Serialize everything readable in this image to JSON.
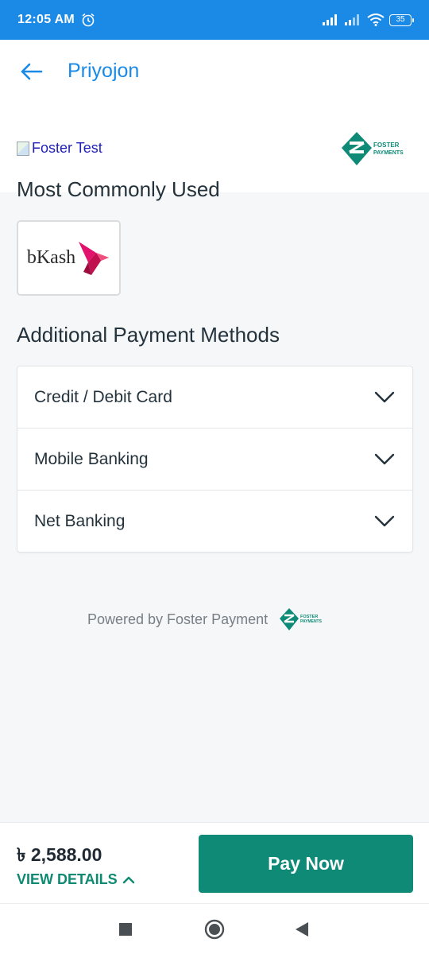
{
  "status_bar": {
    "time": "12:05 AM",
    "battery": "35"
  },
  "header": {
    "title": "Priyojon"
  },
  "merchant": {
    "logo_alt": "Foster Test"
  },
  "brand_logo": {
    "line1": "FOSTER",
    "line2": "PAYMENTS"
  },
  "sections": {
    "common_title": "Most Commonly Used",
    "additional_title": "Additional Payment Methods"
  },
  "common_methods": [
    {
      "label": "bKash"
    }
  ],
  "additional_methods": [
    {
      "label": "Credit / Debit Card"
    },
    {
      "label": "Mobile Banking"
    },
    {
      "label": "Net Banking"
    }
  ],
  "footer": {
    "powered_by": "Powered by Foster Payment"
  },
  "pay_bar": {
    "amount": "৳ 2,588.00",
    "view_details": "VIEW DETAILS",
    "pay_button": "Pay Now"
  },
  "colors": {
    "status_bar": "#1a8ae6",
    "accent_blue": "#1a8ae6",
    "pay_green": "#0e8a76",
    "bkash_pink": "#d2155a"
  }
}
